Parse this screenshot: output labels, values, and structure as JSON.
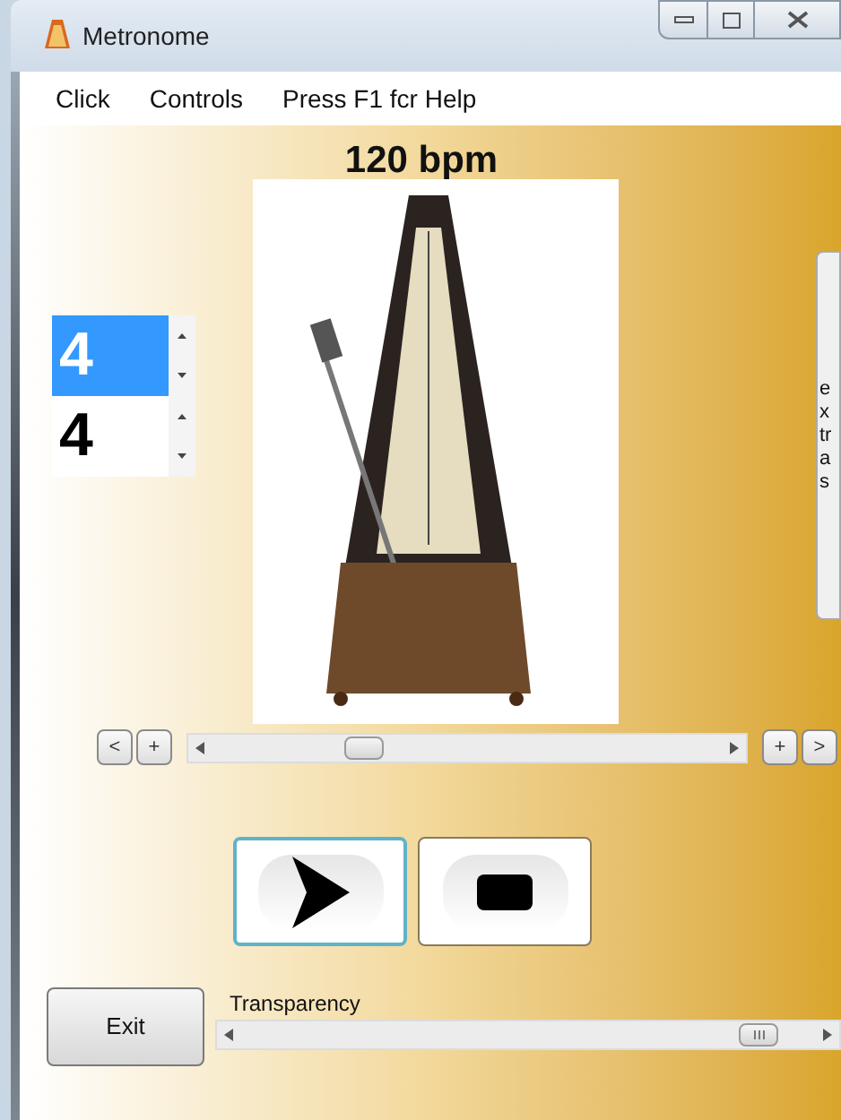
{
  "window": {
    "title": "Metronome"
  },
  "menu": [
    "Click",
    "Controls",
    "Press F1 fcr Help"
  ],
  "tempo_display": "120 bpm",
  "time_signature": [
    {
      "value": "4",
      "selected": true
    },
    {
      "value": "4",
      "selected": false
    }
  ],
  "side_panel": {
    "text_lines": [
      "e",
      "x",
      "tr",
      "a",
      "s"
    ]
  },
  "tempo_slider": {
    "left_buttons": [
      "<",
      "+"
    ],
    "right_buttons": [
      "+",
      ">"
    ],
    "level": 0.28
  },
  "transport": [
    {
      "kind": "play",
      "selected": true
    },
    {
      "kind": "stop",
      "selected": false
    }
  ],
  "exit_button": "Exit",
  "transparency": {
    "label": "Transparency",
    "level": 0.93
  }
}
